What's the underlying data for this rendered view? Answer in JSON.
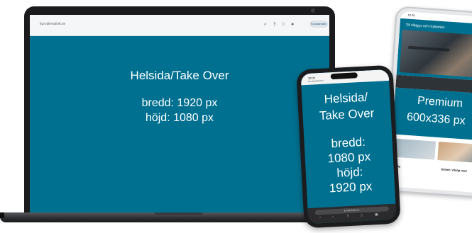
{
  "laptop": {
    "browser_tab": "kurvakreativit.se",
    "profile_label": "Kurvakreativ",
    "heading": "Helsida/Take Over",
    "width_text": "bredd: 1920 px",
    "height_text": "höjd: 1080 px",
    "screen_color": "#007090"
  },
  "phone_center": {
    "status_time": "10:00",
    "status_url": "kurvakreativit.se",
    "heading_line1": "Helsida/",
    "heading_line2": "Take Over",
    "width_line1": "bredd:",
    "width_line2": "1080 px",
    "height_line1": "höjd:",
    "height_line2": "1920 px",
    "url_bar": "kurvakreativit.se"
  },
  "phone_right": {
    "status_time": "10:26",
    "header_text": "Till slätgys och mylletries",
    "premium_title": "Premium",
    "premium_size": "600x336 px",
    "card_caption_left": "Evig",
    "card_caption_right": "Debatt: Vikt/gt med"
  }
}
